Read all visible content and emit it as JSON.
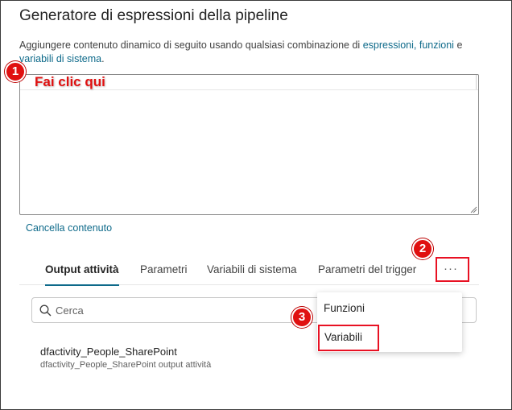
{
  "dialog": {
    "title": "Generatore di espressioni della pipeline",
    "description_prefix": "Aggiungere contenuto dinamico di seguito usando qualsiasi combinazione di",
    "link_expressions": "espressioni,",
    "link_functions": "funzioni",
    "description_and": "e",
    "link_variables": "variabili di sistema",
    "description_suffix": ".",
    "clear_label": "Cancella contenuto"
  },
  "tabs": [
    {
      "label": "Output attività",
      "active": true
    },
    {
      "label": "Parametri"
    },
    {
      "label": "Variabili di sistema"
    },
    {
      "label": "Parametri del trigger"
    }
  ],
  "more_label": "···",
  "search": {
    "placeholder": "Cerca"
  },
  "activity": {
    "name": "dfactivity_People_SharePoint",
    "subtitle": "dfactivity_People_SharePoint output attività"
  },
  "menu": {
    "items": [
      "Funzioni",
      "Variabili"
    ]
  },
  "annotations": {
    "step1": "1",
    "step2": "2",
    "step3": "3",
    "callout": "Fai clic qui",
    "color": "#e01010"
  },
  "colors": {
    "accent": "#0e6a8a",
    "highlight": "#e81123"
  }
}
